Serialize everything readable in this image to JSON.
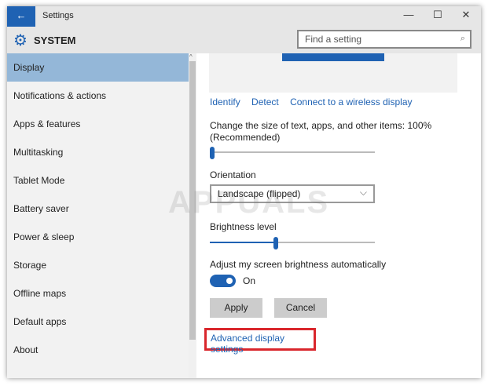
{
  "window": {
    "title": "Settings",
    "back_icon": "←",
    "minimize": "—",
    "maximize": "☐",
    "close": "✕"
  },
  "header": {
    "section": "SYSTEM",
    "search_placeholder": "Find a setting",
    "search_icon": "⌕"
  },
  "sidebar": {
    "items": [
      {
        "label": "Display",
        "selected": true
      },
      {
        "label": "Notifications & actions"
      },
      {
        "label": "Apps & features"
      },
      {
        "label": "Multitasking"
      },
      {
        "label": "Tablet Mode"
      },
      {
        "label": "Battery saver"
      },
      {
        "label": "Power & sleep"
      },
      {
        "label": "Storage"
      },
      {
        "label": "Offline maps"
      },
      {
        "label": "Default apps"
      },
      {
        "label": "About"
      }
    ]
  },
  "main": {
    "links": [
      "Identify",
      "Detect",
      "Connect to a wireless display"
    ],
    "scale_label": "Change the size of text, apps, and other items: 100%",
    "scale_sub": "(Recommended)",
    "scale_value": 0,
    "orientation_label": "Orientation",
    "orientation_value": "Landscape (flipped)",
    "brightness_label": "Brightness level",
    "brightness_value": 40,
    "auto_label": "Adjust my screen brightness automatically",
    "auto_state": "On",
    "apply": "Apply",
    "cancel": "Cancel",
    "advanced": "Advanced display settings"
  },
  "watermark": "APPUALS"
}
